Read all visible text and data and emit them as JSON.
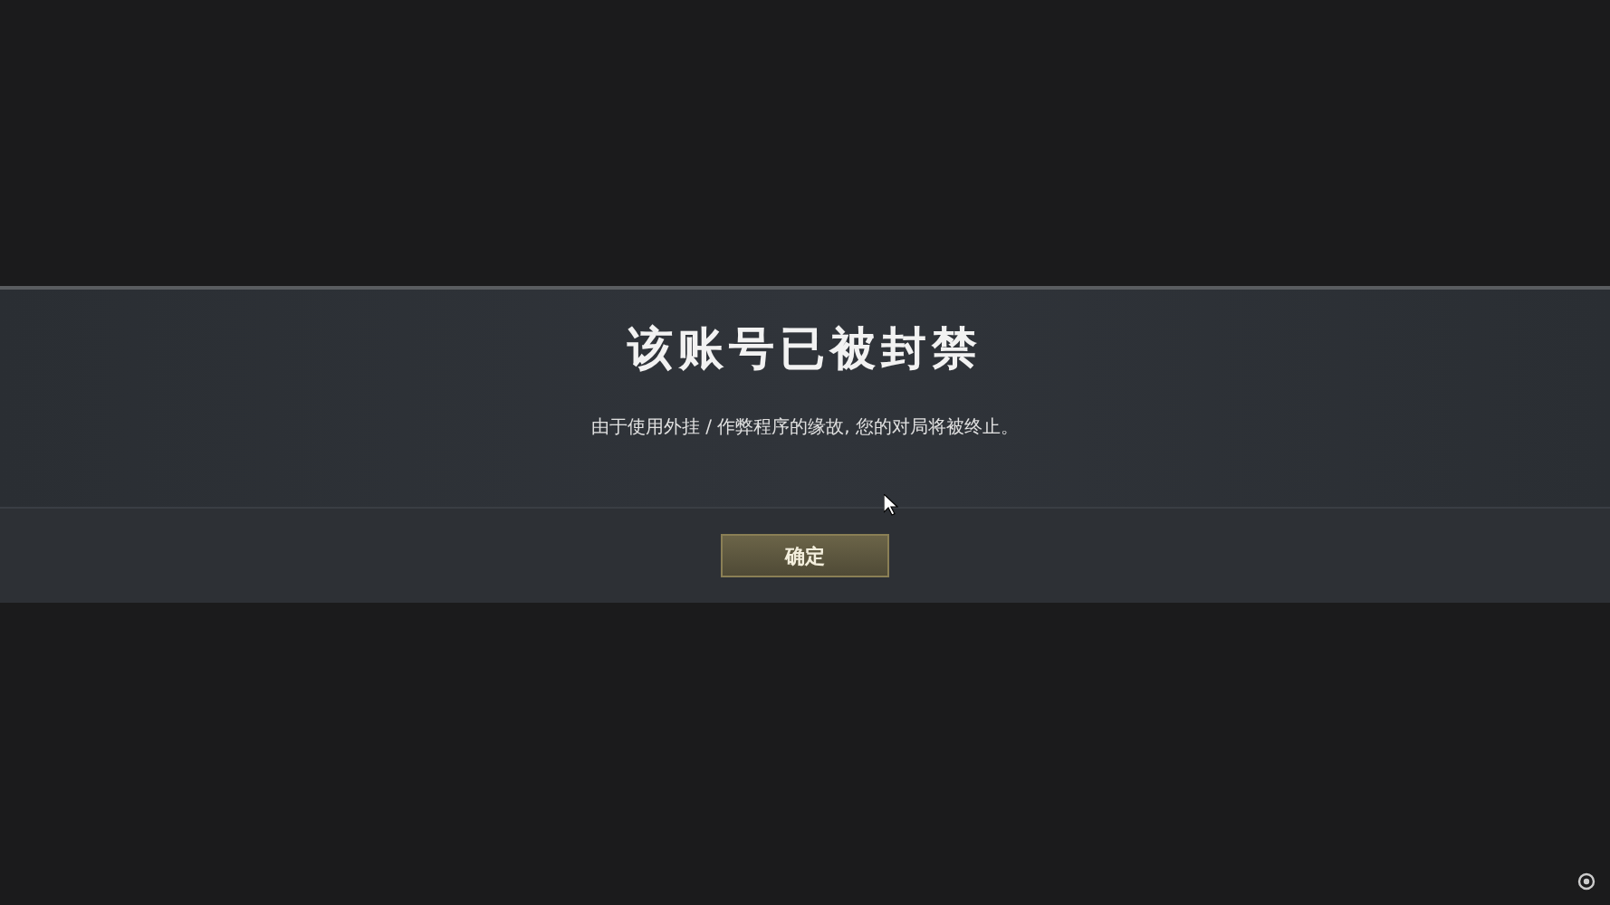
{
  "dialog": {
    "title": "该账号已被封禁",
    "message": "由于使用外挂 / 作弊程序的缘故, 您的对局将被终止。",
    "buttons": [
      "确定"
    ]
  }
}
